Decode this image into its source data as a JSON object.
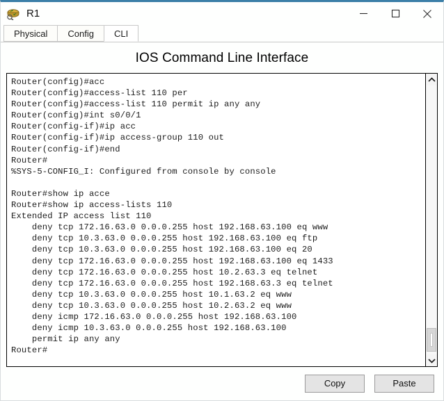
{
  "window": {
    "title": "R1",
    "icon": "router-icon",
    "controls": {
      "minimize": "minimize-icon",
      "maximize": "maximize-icon",
      "close": "close-icon"
    }
  },
  "tabs": [
    {
      "label": "Physical",
      "active": false
    },
    {
      "label": "Config",
      "active": false
    },
    {
      "label": "CLI",
      "active": true
    }
  ],
  "heading": "IOS Command Line Interface",
  "terminal": {
    "lines": [
      "Router(config)#acc",
      "Router(config)#access-list 110 per",
      "Router(config)#access-list 110 permit ip any any",
      "Router(config)#int s0/0/1",
      "Router(config-if)#ip acc",
      "Router(config-if)#ip access-group 110 out",
      "Router(config-if)#end",
      "Router#",
      "%SYS-5-CONFIG_I: Configured from console by console",
      "",
      "Router#show ip acce",
      "Router#show ip access-lists 110",
      "Extended IP access list 110",
      "    deny tcp 172.16.63.0 0.0.0.255 host 192.168.63.100 eq www",
      "    deny tcp 10.3.63.0 0.0.0.255 host 192.168.63.100 eq ftp",
      "    deny tcp 10.3.63.0 0.0.0.255 host 192.168.63.100 eq 20",
      "    deny tcp 172.16.63.0 0.0.0.255 host 192.168.63.100 eq 1433",
      "    deny tcp 172.16.63.0 0.0.0.255 host 10.2.63.3 eq telnet",
      "    deny tcp 172.16.63.0 0.0.0.255 host 192.168.63.3 eq telnet",
      "    deny tcp 10.3.63.0 0.0.0.255 host 10.1.63.2 eq www",
      "    deny tcp 10.3.63.0 0.0.0.255 host 10.2.63.2 eq www",
      "    deny icmp 172.16.63.0 0.0.0.255 host 192.168.63.100",
      "    deny icmp 10.3.63.0 0.0.0.255 host 192.168.63.100",
      "    permit ip any any",
      "Router#"
    ]
  },
  "scrollbar": {
    "up_arrow": "chevron-up-icon",
    "down_arrow": "chevron-down-icon"
  },
  "footer": {
    "copy_label": "Copy",
    "paste_label": "Paste"
  },
  "colors": {
    "accent_border": "#3b7fa8",
    "window_bg": "#fefffe",
    "terminal_bg": "#ffffff",
    "terminal_text": "#1c1c1c",
    "button_bg": "#e4e4e4"
  }
}
